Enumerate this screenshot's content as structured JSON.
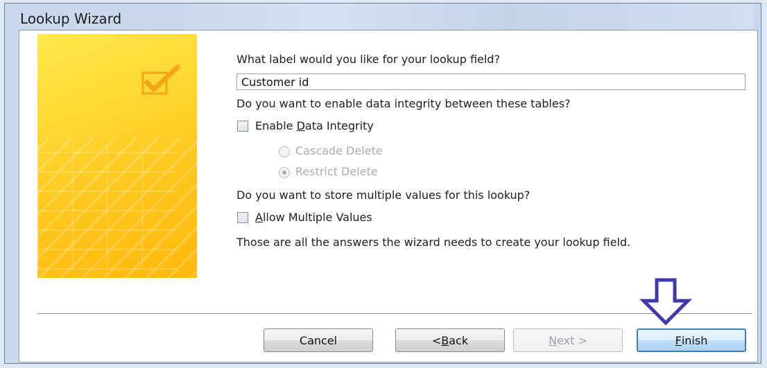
{
  "window": {
    "title": "Lookup Wizard"
  },
  "wizard": {
    "label_prompt": "What label would you like for your lookup field?",
    "label_value": "Customer id",
    "integrity_prompt": "Do you want to enable data integrity between these tables?",
    "enable_integrity": {
      "label_pre": "Enable ",
      "label_accel": "D",
      "label_post": "ata Integrity",
      "checked": false
    },
    "cascade_delete": {
      "label": "Cascade Delete",
      "selected": false,
      "enabled": false
    },
    "restrict_delete": {
      "label": "Restrict Delete",
      "selected": true,
      "enabled": false
    },
    "multi_prompt": "Do you want to store multiple values for this lookup?",
    "allow_multiple": {
      "label_accel": "A",
      "label_post": "llow Multiple Values",
      "checked": false
    },
    "final_note": "Those are all the answers the wizard needs to create your lookup field."
  },
  "buttons": {
    "cancel": "Cancel",
    "back": {
      "pre": "< ",
      "accel": "B",
      "post": "ack"
    },
    "next": {
      "accel": "N",
      "post": "ext >",
      "enabled": false
    },
    "finish": {
      "accel": "F",
      "post": "inish"
    }
  },
  "colors": {
    "accent_arrow": "#3d3aa8",
    "banner_yellow": "#ffd934",
    "primary_border": "#3c7fb1"
  },
  "icons": {
    "banner_icon": "checkbox-check-icon",
    "annotation": "down-arrow-icon"
  }
}
